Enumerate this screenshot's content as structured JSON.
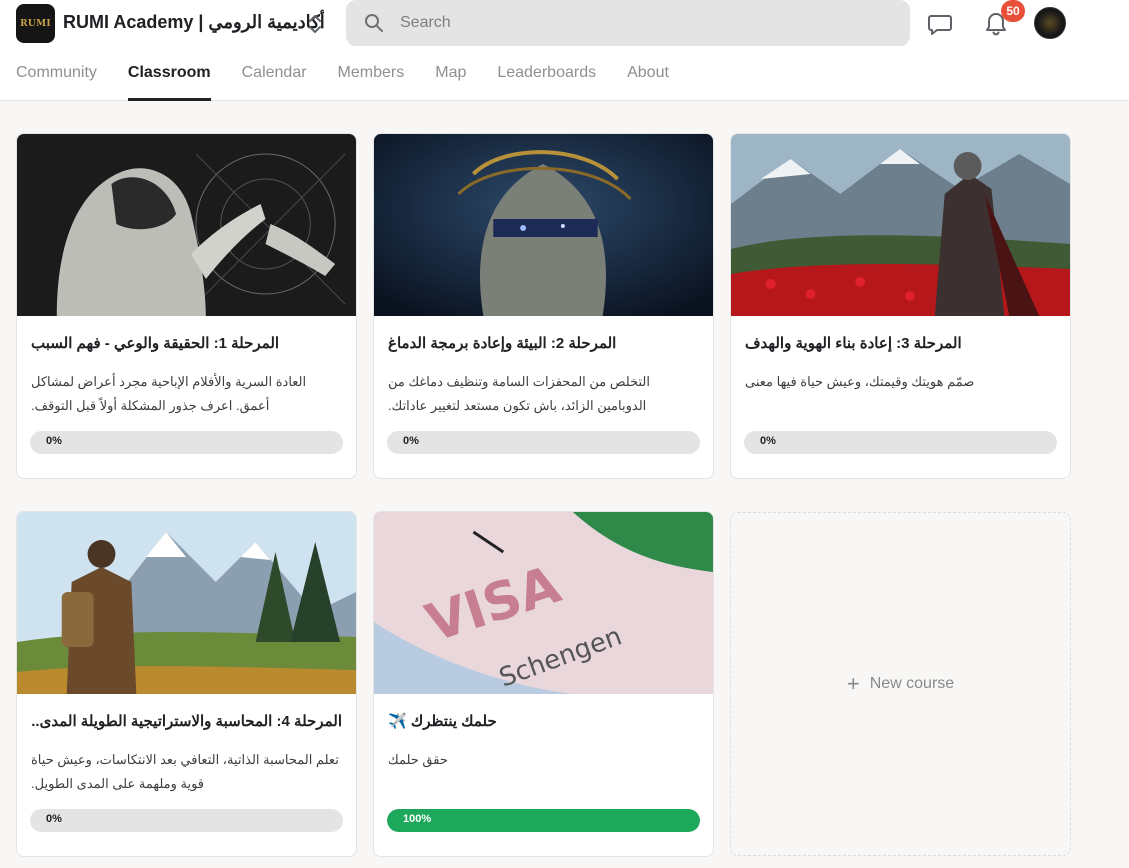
{
  "header": {
    "title": "RUMI Academy | أكاديمية الرومي",
    "logo_text": "RUMI",
    "search_placeholder": "Search",
    "notification_count": "50"
  },
  "tabs": [
    {
      "label": "Community",
      "active": false
    },
    {
      "label": "Classroom",
      "active": true
    },
    {
      "label": "Calendar",
      "active": false
    },
    {
      "label": "Members",
      "active": false
    },
    {
      "label": "Map",
      "active": false
    },
    {
      "label": "Leaderboards",
      "active": false
    },
    {
      "label": "About",
      "active": false
    }
  ],
  "courses": [
    {
      "title": "المرحلة 1: الحقيقة والوعي - فهم السبب",
      "description": "العادة السرية والأفلام الإباحية مجرد أعراض لمشاكل أعمق. اعرف جذور المشكلة أولاً قبل التوقف.",
      "progress_label": "0%",
      "progress": 0
    },
    {
      "title": "المرحلة 2: البيئة وإعادة برمجة الدماغ",
      "description": "التخلص من المحفزات السامة وتنظيف دماغك من الدوبامين الزائد، باش تكون مستعد لتغيير عاداتك.",
      "progress_label": "0%",
      "progress": 0
    },
    {
      "title": "المرحلة 3: إعادة بناء الهوية والهدف",
      "description": "صمّم هويتك وقيمتك، وعيش حياة فيها معنى",
      "progress_label": "0%",
      "progress": 0
    },
    {
      "title": "المرحلة 4: المحاسبة والاستراتيجية الطويلة المدى...",
      "description": "تعلم المحاسبة الذاتية، التعافي بعد الانتكاسات، وعيش حياة قوية وملهمة على المدى الطويل.",
      "progress_label": "0%",
      "progress": 0
    },
    {
      "title": "حلمك ينتظرك ✈️",
      "description": "حقق حلمك",
      "progress_label": "100%",
      "progress": 1
    }
  ],
  "new_course_label": "New course",
  "colors": {
    "accent": "#1ea85b",
    "badge": "#e8503a",
    "track": "#e4e4e4",
    "text": "#202124"
  },
  "thumbnail_art": [
    "hooded-figure-sketch",
    "blindfolded-statue",
    "knight-red-poppies",
    "hiker-mountains",
    "schengen-visa"
  ],
  "thumbnail_labels": [
    "VISA",
    "Schengen"
  ]
}
